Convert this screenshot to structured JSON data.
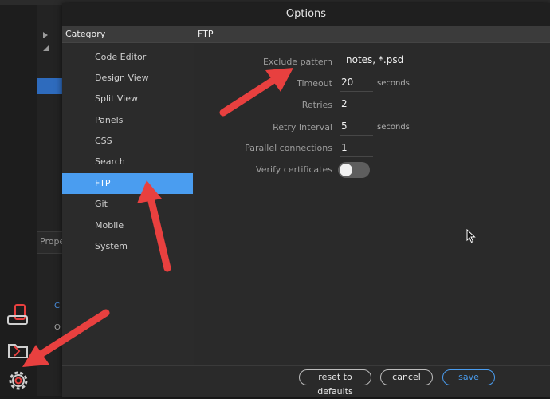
{
  "dialog": {
    "title": "Options",
    "category_header": "Category",
    "section_header": "FTP"
  },
  "categories": [
    {
      "label": "Code Editor",
      "active": false
    },
    {
      "label": "Design View",
      "active": false
    },
    {
      "label": "Split View",
      "active": false
    },
    {
      "label": "Panels",
      "active": false
    },
    {
      "label": "CSS",
      "active": false
    },
    {
      "label": "Search",
      "active": false
    },
    {
      "label": "FTP",
      "active": true
    },
    {
      "label": "Git",
      "active": false
    },
    {
      "label": "Mobile",
      "active": false
    },
    {
      "label": "System",
      "active": false
    }
  ],
  "ftp": {
    "exclude_pattern": {
      "label": "Exclude pattern",
      "value": "_notes, *.psd"
    },
    "timeout": {
      "label": "Timeout",
      "value": "20",
      "unit": "seconds"
    },
    "retries": {
      "label": "Retries",
      "value": "2"
    },
    "retry_interval": {
      "label": "Retry Interval",
      "value": "5",
      "unit": "seconds"
    },
    "parallel_connections": {
      "label": "Parallel connections",
      "value": "1"
    },
    "verify_certificates": {
      "label": "Verify certificates",
      "enabled": false
    }
  },
  "buttons": {
    "reset": "reset to defaults",
    "cancel": "cancel",
    "save": "save"
  },
  "background": {
    "panel_label": "Prope",
    "left_char_1": "C",
    "left_char_2": "O"
  },
  "colors": {
    "accent": "#4a9df0",
    "annotation_arrow": "#e8403f",
    "dialog_bg": "#2a2a2a"
  },
  "icons": [
    "device-icon",
    "extract-icon",
    "gear-icon",
    "cursor-icon",
    "annotation-arrow"
  ]
}
